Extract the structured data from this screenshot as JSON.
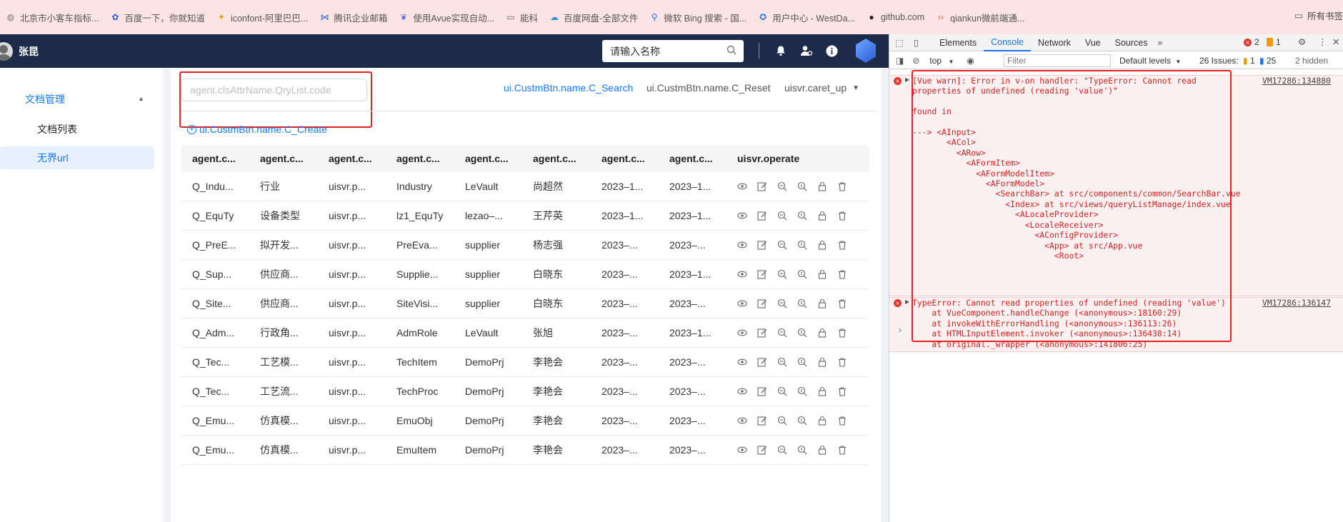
{
  "bookmarks": [
    {
      "label": "北京市小客车指标...",
      "icon": "globe-icon"
    },
    {
      "label": "百度一下，你就知道",
      "icon": "baidu-icon"
    },
    {
      "label": "iconfont-阿里巴巴...",
      "icon": "iconfont-icon"
    },
    {
      "label": "腾讯企业邮箱",
      "icon": "mail-icon"
    },
    {
      "label": "使用Avue实现自动...",
      "icon": "avue-icon"
    },
    {
      "label": "能科",
      "icon": "folder-icon"
    },
    {
      "label": "百度网盘-全部文件",
      "icon": "cloud-icon"
    },
    {
      "label": "微软 Bing 搜索 - 国...",
      "icon": "bing-icon"
    },
    {
      "label": "用户中心 - WestDa...",
      "icon": "user-icon"
    },
    {
      "label": "github.com",
      "icon": "github-icon"
    },
    {
      "label": "qiankun微前端通...",
      "icon": "code-icon"
    }
  ],
  "bookmarks_all": "所有书签",
  "header": {
    "username": "张昆",
    "search_placeholder": "请输入名称"
  },
  "sidebar": {
    "group_label": "文档管理",
    "items": [
      {
        "label": "文档列表",
        "active": false
      },
      {
        "label": "无界url",
        "active": true
      }
    ]
  },
  "filter": {
    "placeholder": "agent.clsAttrName.QryList.code",
    "search_label": "ui.CustmBtn.name.C_Search",
    "reset_label": "ui.CustmBtn.name.C_Reset",
    "caret_label": "uisvr.caret_up",
    "create_label": "ui.CustmBtn.name.C_Create"
  },
  "table": {
    "headers": [
      "agent.c...",
      "agent.c...",
      "agent.c...",
      "agent.c...",
      "agent.c...",
      "agent.c...",
      "agent.c...",
      "agent.c...",
      "uisvr.operate"
    ],
    "rows": [
      [
        "Q_Indu...",
        "行业",
        "uisvr.p...",
        "Industry",
        "LeVault",
        "尚超然",
        "2023–1...",
        "2023–1..."
      ],
      [
        "Q_EquTy",
        "设备类型",
        "uisvr.p...",
        "lz1_EquTy",
        "lezao–...",
        "王芹英",
        "2023–1...",
        "2023–1..."
      ],
      [
        "Q_PreE...",
        "拟开发...",
        "uisvr.p...",
        "PreEva...",
        "supplier",
        "杨志强",
        "2023–...",
        "2023–..."
      ],
      [
        "Q_Sup...",
        "供应商...",
        "uisvr.p...",
        "Supplie...",
        "supplier",
        "白晓东",
        "2023–...",
        "2023–1..."
      ],
      [
        "Q_Site...",
        "供应商...",
        "uisvr.p...",
        "SiteVisi...",
        "supplier",
        "白晓东",
        "2023–...",
        "2023–..."
      ],
      [
        "Q_Adm...",
        "行政角...",
        "uisvr.p...",
        "AdmRole",
        "LeVault",
        "张旭",
        "2023–...",
        "2023–1..."
      ],
      [
        "Q_Tec...",
        "工艺模...",
        "uisvr.p...",
        "TechItem",
        "DemoPrj",
        "李艳会",
        "2023–...",
        "2023–..."
      ],
      [
        "Q_Tec...",
        "工艺流...",
        "uisvr.p...",
        "TechProc",
        "DemoPrj",
        "李艳会",
        "2023–...",
        "2023–..."
      ],
      [
        "Q_Emu...",
        "仿真模...",
        "uisvr.p...",
        "EmuObj",
        "DemoPrj",
        "李艳会",
        "2023–...",
        "2023–..."
      ],
      [
        "Q_Emu...",
        "仿真模...",
        "uisvr.p...",
        "EmuItem",
        "DemoPrj",
        "李艳会",
        "2023–...",
        "2023–..."
      ]
    ]
  },
  "devtools": {
    "tabs": [
      "Elements",
      "Console",
      "Network",
      "Vue",
      "Sources"
    ],
    "active_tab": "Console",
    "error_count": "2",
    "warn_count": "1",
    "context": "top",
    "filter_placeholder": "Filter",
    "levels": "Default levels",
    "issues_label": "26 Issues:",
    "issues_warn": "1",
    "issues_info": "25",
    "hidden": "2 hidden",
    "msg1_text": "[Vue warn]: Error in v-on handler: \"TypeError: Cannot read\nproperties of undefined (reading 'value')\"\n\nfound in\n\n---> <AInput>\n       <ACol>\n         <ARow>\n           <AFormItem>\n             <AFormModelItem>\n               <AFormModel>\n                 <SearchBar> at src/components/common/SearchBar.vue\n                   <Index> at src/views/queryListManage/index.vue\n                     <ALocaleProvider>\n                       <LocaleReceiver>\n                         <AConfigProvider>\n                           <App> at src/App.vue\n                             <Root>",
    "msg1_src": "VM17286:134880",
    "msg2_text": "TypeError: Cannot read properties of undefined (reading 'value')\n    at VueComponent.handleChange (<anonymous>:18160:29)\n    at invokeWithErrorHandling (<anonymous>:136113:26)\n    at HTMLInputElement.invoker (<anonymous>:136438:14)\n    at original._wrapper (<anonymous>:141806:25)",
    "msg2_src": "VM17286:136147"
  },
  "colors": {
    "header_bg": "#1d2a4a",
    "accent": "#1677ff",
    "error": "#d32020",
    "highlight_box": "#e52222"
  }
}
